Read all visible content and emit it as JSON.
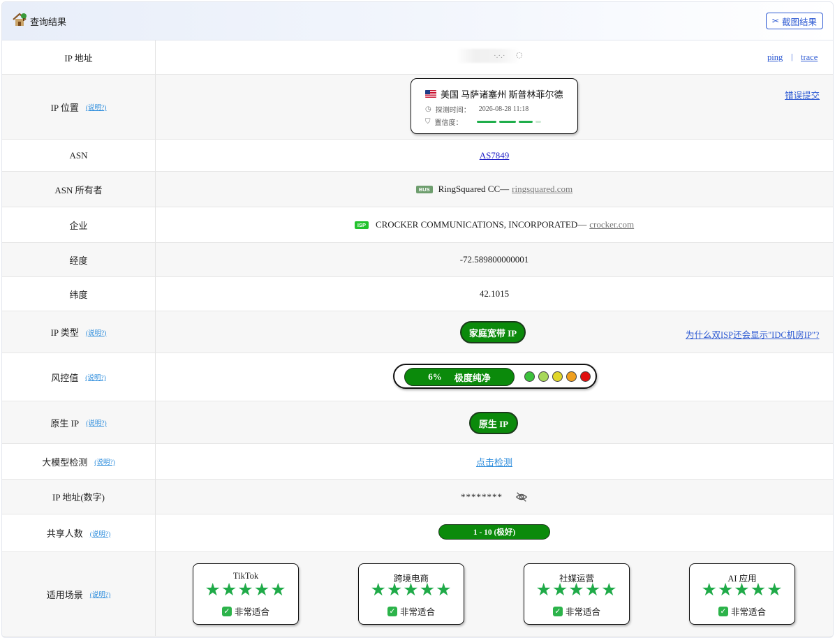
{
  "header": {
    "title": "查询结果",
    "screenshot_button": "截图结果",
    "icons": {
      "house": "house-icon",
      "scissors": "scissors-icon"
    }
  },
  "rows": {
    "ip_address": {
      "label": "IP 地址",
      "value": "·.·.·",
      "ping": "ping",
      "separator": "|",
      "trace": "trace"
    },
    "ip_location": {
      "label": "IP 位置",
      "help": "(说明?)",
      "location": "美国 马萨诸塞州 斯普林菲尔德",
      "probe_label": "探测时间：",
      "probe_time": "2026-08-28 11:18",
      "confidence_label": "置信度：",
      "confidence_level": 0.88,
      "report": "错误提交"
    },
    "asn": {
      "label": "ASN",
      "value": "AS7849"
    },
    "asn_owner": {
      "label": "ASN 所有者",
      "badge": "BUS",
      "name": "RingSquared CC",
      "dash": "—",
      "domain": "ringsquared.com"
    },
    "company": {
      "label": "企业",
      "badge": "ISP",
      "name": "CROCKER COMMUNICATIONS, INCORPORATED",
      "dash": "—",
      "domain": "crocker.com"
    },
    "longitude": {
      "label": "经度",
      "value": "-72.589800000001"
    },
    "latitude": {
      "label": "纬度",
      "value": "42.1015"
    },
    "ip_type": {
      "label": "IP 类型",
      "help": "(说明?)",
      "value": "家庭宽带 IP",
      "link": "为什么双ISP还会显示\"IDC机房IP\"?"
    },
    "risk": {
      "label": "风控值",
      "help": "(说明?)",
      "percent": "6%",
      "text": "极度纯净",
      "dot_colors": [
        "#3cc13c",
        "#a8d85a",
        "#e0d62a",
        "#f0a020",
        "#e01010"
      ]
    },
    "native_ip": {
      "label": "原生 IP",
      "help": "(说明?)",
      "value": "原生 IP"
    },
    "llm_check": {
      "label": "大模型检测",
      "help": "(说明?)",
      "value": "点击检测"
    },
    "ip_numeric": {
      "label": "IP 地址(数字)",
      "value": "********"
    },
    "shared_users": {
      "label": "共享人数",
      "help": "(说明?)",
      "value": "1 - 10 (极好)"
    },
    "scenarios": {
      "label": "适用场景",
      "help": "(说明?)",
      "items": [
        {
          "name": "TikTok",
          "stars": "★★★★★",
          "rating": 5,
          "verdict": "非常适合"
        },
        {
          "name": "跨境电商",
          "stars": "★★★★★",
          "rating": 5,
          "verdict": "非常适合"
        },
        {
          "name": "社媒运营",
          "stars": "★★★★★",
          "rating": 5,
          "verdict": "非常适合"
        },
        {
          "name": "AI 应用",
          "stars": "★★★★★",
          "rating": 5,
          "verdict": "非常适合"
        }
      ]
    }
  },
  "colors": {
    "accent": "#2f5bd3",
    "green": "#0b8a0b",
    "star": "#1faa48"
  }
}
